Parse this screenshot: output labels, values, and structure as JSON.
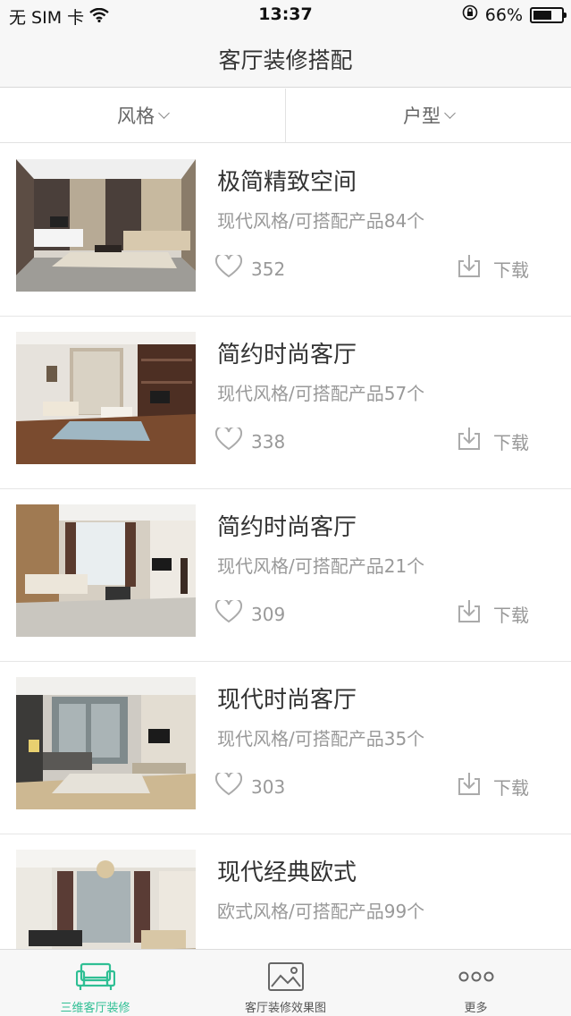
{
  "status_bar": {
    "carrier": "无 SIM 卡",
    "time": "13:37",
    "battery_percent": "66%",
    "battery_level": 0.66
  },
  "nav": {
    "title": "客厅装修搭配"
  },
  "filters": [
    {
      "label": "风格"
    },
    {
      "label": "户型"
    }
  ],
  "items": [
    {
      "title": "极简精致空间",
      "subtitle": "现代风格/可搭配产品84个",
      "likes": "352",
      "download_label": "下载"
    },
    {
      "title": "简约时尚客厅",
      "subtitle": "现代风格/可搭配产品57个",
      "likes": "338",
      "download_label": "下载"
    },
    {
      "title": "简约时尚客厅",
      "subtitle": "现代风格/可搭配产品21个",
      "likes": "309",
      "download_label": "下载"
    },
    {
      "title": "现代时尚客厅",
      "subtitle": "现代风格/可搭配产品35个",
      "likes": "303",
      "download_label": "下载"
    },
    {
      "title": "现代经典欧式",
      "subtitle": "欧式风格/可搭配产品99个",
      "likes": "",
      "download_label": ""
    }
  ],
  "tabs": [
    {
      "label": "三维客厅装修",
      "icon": "sofa-icon",
      "active": true
    },
    {
      "label": "客厅装修效果图",
      "icon": "image-icon",
      "active": false
    },
    {
      "label": "更多",
      "icon": "more-icon",
      "active": false
    }
  ],
  "colors": {
    "accent": "#2fbf94",
    "muted_text": "#999999",
    "title_text": "#333333"
  }
}
